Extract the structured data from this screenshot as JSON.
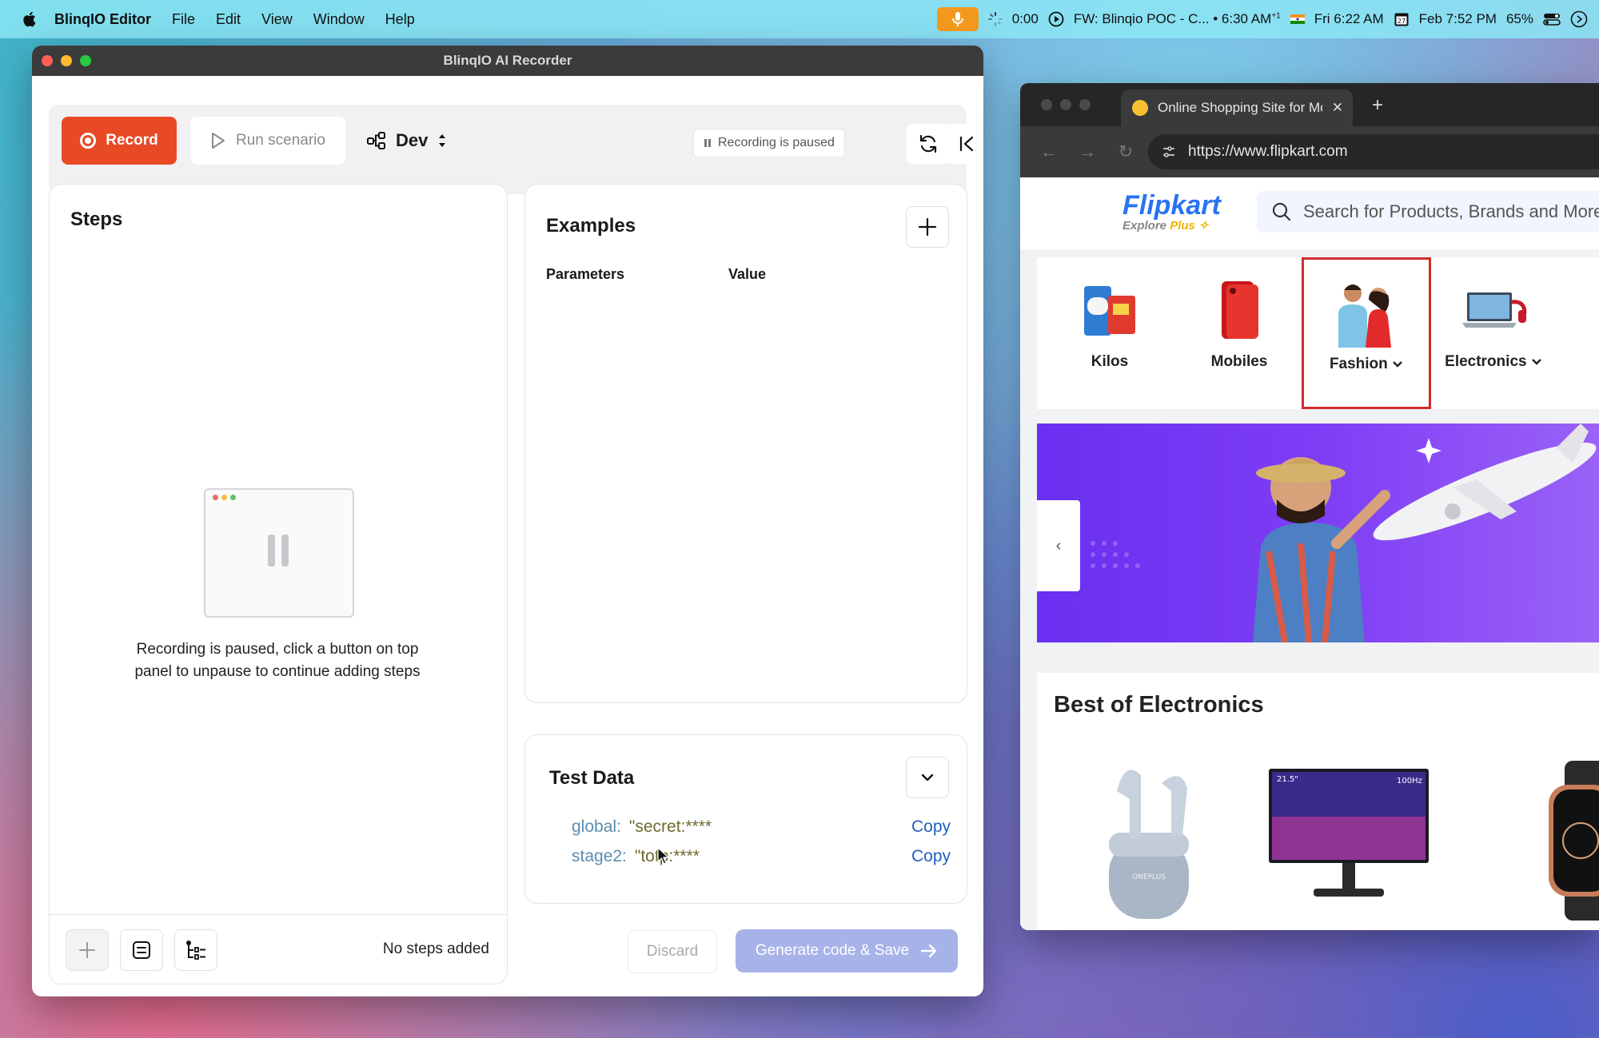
{
  "menubar": {
    "app_name": "BlinqIO Editor",
    "items": [
      "File",
      "Edit",
      "View",
      "Window",
      "Help"
    ],
    "timer": "0:00",
    "meeting": "FW: Blinqio POC - C... • 6:30 AM",
    "meeting_suffix": "+1",
    "clock1": "Fri 6:22 AM",
    "clock2": "Feb  7:52 PM",
    "battery": "65%"
  },
  "recorder": {
    "window_title": "BlinqIO AI Recorder",
    "record_label": "Record",
    "run_label": "Run scenario",
    "env_label": "Dev",
    "status_chip": "Recording is paused",
    "steps_title": "Steps",
    "paused_message": "Recording is paused, click a button on top panel to unpause to continue adding steps",
    "no_steps": "No steps added",
    "examples_title": "Examples",
    "col_parameters": "Parameters",
    "col_value": "Value",
    "test_data_title": "Test Data",
    "test_data": [
      {
        "key": "global:",
        "value": "\"secret:****",
        "copy": "Copy"
      },
      {
        "key": "stage2:",
        "value": "\"totp:****",
        "copy": "Copy"
      }
    ],
    "discard_label": "Discard",
    "generate_label": "Generate code & Save"
  },
  "browser": {
    "tab_title": "Online Shopping Site for Mobiles, Electronics",
    "url": "https://www.flipkart.com",
    "logo": "Flipkart",
    "logo_sub_prefix": "Explore",
    "logo_sub_plus": "Plus",
    "search_placeholder": "Search for Products, Brands and More",
    "categories": [
      {
        "label": "Kilos"
      },
      {
        "label": "Mobiles"
      },
      {
        "label": "Fashion",
        "selected": true
      },
      {
        "label": "Electronics"
      }
    ],
    "best_title": "Best of Electronics"
  },
  "colors": {
    "record": "#e84a26",
    "generate": "#a7b3e8",
    "flipkart_blue": "#2874f0",
    "selection": "#d32c2c"
  }
}
